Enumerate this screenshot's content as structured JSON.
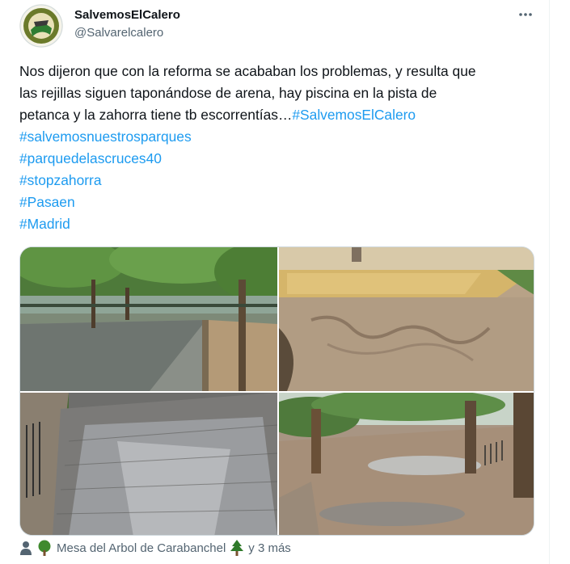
{
  "author": {
    "display_name": "SalvemosElCalero",
    "handle": "@Salvarelcalero",
    "avatar_icon": "club-logo-icon"
  },
  "more_icon": "ellipsis-icon",
  "tweet": {
    "text_line1": "Nos dijeron que con la reforma se acababan los problemas, y resulta que",
    "text_line2": "las rejillas siguen taponándose de arena, hay piscina en la pista de",
    "text_line3_plain": "petanca y la zahorra tiene tb escorrentías…",
    "hashtags": [
      "#SalvemosElCalero",
      "#salvemosnuestrosparques",
      "#parquedelascruces40",
      "#stopzahorra",
      "#Pasaen",
      "#Madrid"
    ]
  },
  "media": {
    "photos": [
      "park-petanque-flooded",
      "sand-path-erosion",
      "wet-brick-pavement",
      "puddled-gravel-path"
    ]
  },
  "footer": {
    "tagged_name": "Mesa del Arbol de Carabanchel",
    "more_text": "y 3 más",
    "icons": [
      "person-icon",
      "tree-icon",
      "evergreen-tree-icon"
    ]
  },
  "colors": {
    "accent": "#1d9bf0",
    "text": "#0f1419",
    "secondary": "#536471"
  }
}
